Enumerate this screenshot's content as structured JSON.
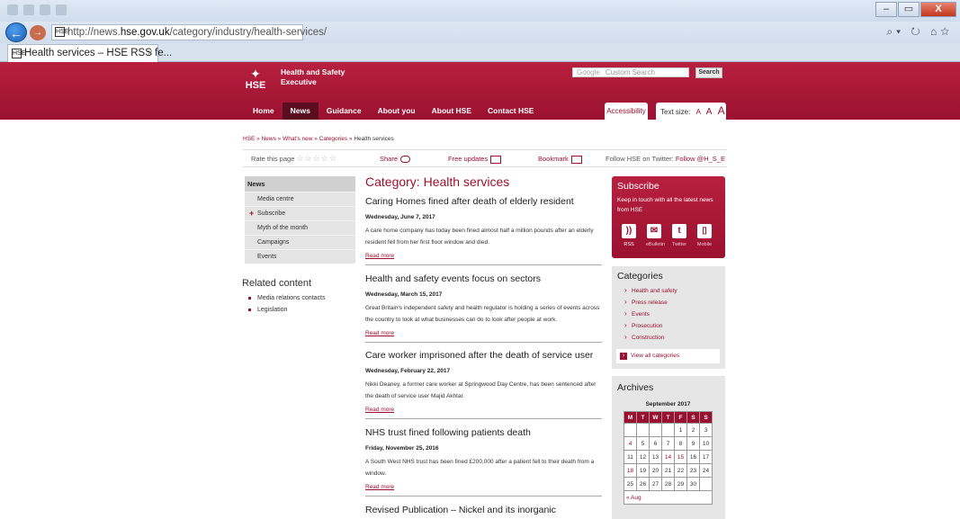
{
  "browser": {
    "url_prefix": "http://news.",
    "url_host": "hse.gov.uk",
    "url_path": "/category/industry/health-services/",
    "tab_title": "Health services – HSE RSS fe...",
    "tab_close": "×",
    "favicon_text": "HSE",
    "back_icon": "←",
    "forward_icon": "→",
    "addr_right_icons": "⌕▾ ↻ ⌂☆",
    "window": {
      "minimize": "–",
      "maximize": "▭",
      "close": "X"
    }
  },
  "header": {
    "logo_letters": "HSE",
    "logo_mark": "✦",
    "org_name_line1": "Health and Safety",
    "org_name_line2": "Executive",
    "search": {
      "brand": "Google",
      "placeholder": "Custom Search",
      "button": "Search"
    },
    "nav": [
      {
        "label": "Home"
      },
      {
        "label": "News"
      },
      {
        "label": "Guidance"
      },
      {
        "label": "About you"
      },
      {
        "label": "About HSE"
      },
      {
        "label": "Contact HSE"
      }
    ],
    "accessibility": "Accessibility",
    "text_size": {
      "label": "Text size:",
      "small": "A",
      "medium": "A",
      "large": "A"
    }
  },
  "breadcrumb": {
    "trail": "HSE » News » What's new » Categories »",
    "current": "Health services"
  },
  "toolstrip": {
    "rate": "Rate this page",
    "stars": "☆☆☆☆☆",
    "share": "Share",
    "updates": "Free updates",
    "bookmark": "Bookmark",
    "follow": "Follow HSE on Twitter:",
    "handle": "Follow @H_S_E"
  },
  "leftnav": {
    "heading": "News",
    "items": [
      {
        "label": "Media centre"
      },
      {
        "label": "Subscribe"
      },
      {
        "label": "Myth of the month"
      },
      {
        "label": "Campaigns"
      },
      {
        "label": "Events"
      }
    ]
  },
  "related": {
    "title": "Related content",
    "items": [
      {
        "label": "Media relations contacts"
      },
      {
        "label": "Legislation"
      }
    ]
  },
  "main": {
    "category_title": "Category: Health services",
    "articles": [
      {
        "title": "Caring Homes fined after death of elderly resident",
        "date": "Wednesday, June 7, 2017",
        "desc": "A care home company has today been fined almost half a million pounds after an elderly resident fell from her first floor window and died.",
        "more": "Read more"
      },
      {
        "title": "Health and safety events focus on sectors",
        "date": "Wednesday, March 15, 2017",
        "desc": "Great Britain's independent safety and health regulator is holding a series of events across the country to look at what businesses can do to look after people at work.",
        "more": "Read more"
      },
      {
        "title": "Care worker imprisoned after the death of service user",
        "date": "Wednesday, February 22, 2017",
        "desc": "Nikki Deaney, a former care worker at Springwood Day Centre, has been sentenced after the death of service user Majid Akhtar.",
        "more": "Read more"
      },
      {
        "title": "NHS trust fined following patients death",
        "date": "Friday, November 25, 2016",
        "desc": "A South West NHS trust has been fined £200,000 after a patient fell to their death from a window.",
        "more": "Read more"
      },
      {
        "title": "Revised Publication – Nickel and its inorganic"
      }
    ]
  },
  "subscribe": {
    "title": "Subscribe",
    "blurb": "Keep in touch with all the latest news from HSE",
    "channels": [
      {
        "label": "RSS",
        "glyph": "))"
      },
      {
        "label": "eBulletin",
        "glyph": "✉"
      },
      {
        "label": "Twitter",
        "glyph": "t"
      },
      {
        "label": "Mobile",
        "glyph": "▯"
      }
    ]
  },
  "categories": {
    "title": "Categories",
    "items": [
      {
        "label": "Health and safety"
      },
      {
        "label": "Press release"
      },
      {
        "label": "Events"
      },
      {
        "label": "Prosecution"
      },
      {
        "label": "Construction"
      }
    ],
    "view_all": "View all categories"
  },
  "archives": {
    "title": "Archives",
    "month": "September 2017",
    "days": [
      "M",
      "T",
      "W",
      "T",
      "F",
      "S",
      "S"
    ],
    "weeks": [
      [
        "",
        "",
        "",
        "",
        "1",
        "2",
        "3"
      ],
      [
        "4",
        "5",
        "6",
        "7",
        "8",
        "9",
        "10"
      ],
      [
        "11",
        "12",
        "13",
        "14",
        "15",
        "16",
        "17"
      ],
      [
        "18",
        "19",
        "20",
        "21",
        "22",
        "23",
        "24"
      ],
      [
        "25",
        "26",
        "27",
        "28",
        "29",
        "30",
        ""
      ]
    ],
    "prev": "« Aug",
    "accent": "#9b1030"
  },
  "colors": {
    "brand": "#9b1030",
    "brand_light": "#b8203f",
    "panel": "#e6e6e6"
  }
}
